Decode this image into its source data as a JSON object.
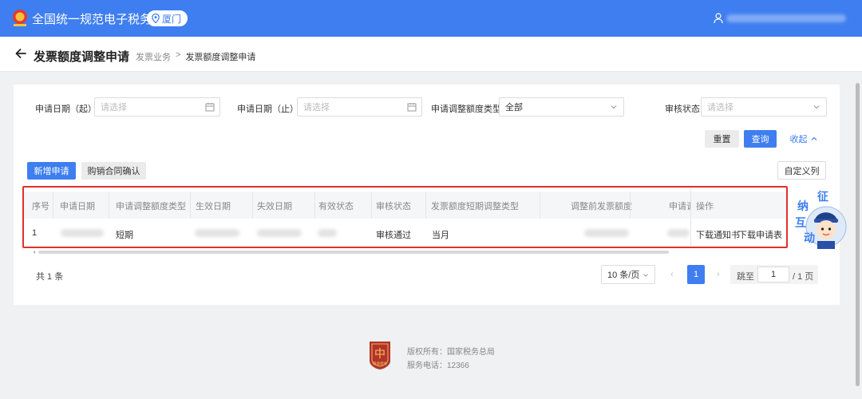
{
  "topbar": {
    "title": "全国统一规范电子税务局",
    "city": "厦门",
    "logo_icon": "tax-emblem-icon",
    "user_icon": "user-icon"
  },
  "header": {
    "title": "发票额度调整申请",
    "breadcrumb": [
      "发票业务",
      "发票额度调整申请"
    ],
    "separator": ">"
  },
  "filters": {
    "start_date": {
      "label": "申请日期（起）",
      "placeholder": "请选择"
    },
    "end_date": {
      "label": "申请日期（止）",
      "placeholder": "请选择"
    },
    "adjust_type": {
      "label": "申请调整额度类型",
      "value": "全部"
    },
    "review_status": {
      "label": "审核状态",
      "placeholder": "请选择"
    },
    "reset": "重置",
    "query": "查询",
    "collapse": "收起"
  },
  "toolbar": {
    "new": "新增申请",
    "confirm": "购销合同确认",
    "custom_columns": "自定义列"
  },
  "table": {
    "columns": [
      "序号",
      "申请日期",
      "申请调整额度类型",
      "生效日期",
      "失效日期",
      "有效状态",
      "审核状态",
      "发票额度短期调整类型",
      "调整前发票额度",
      "申请调"
    ],
    "op_header": "操作",
    "row": {
      "index": "1",
      "adjust_type": "短期",
      "review_status": "审核通过",
      "short_type": "当月",
      "op_notice": "下载通知书",
      "op_form": "下载申请表"
    }
  },
  "pagination": {
    "total": "共 1 条",
    "page_size": "10 条/页",
    "current": "1",
    "jump_label": "跳至",
    "jump_value": "1",
    "pages": "/ 1 页",
    "prev": "‹",
    "next": "›"
  },
  "footer": {
    "copyright": "版权所有：国家税务总局",
    "phone": "服务电话：12366",
    "badge_text": "税收相关"
  },
  "mascot": {
    "text": [
      "征",
      "纳",
      "互",
      "动"
    ]
  },
  "colors": {
    "primary": "#3e7ef0",
    "highlight": "#e0302a"
  }
}
